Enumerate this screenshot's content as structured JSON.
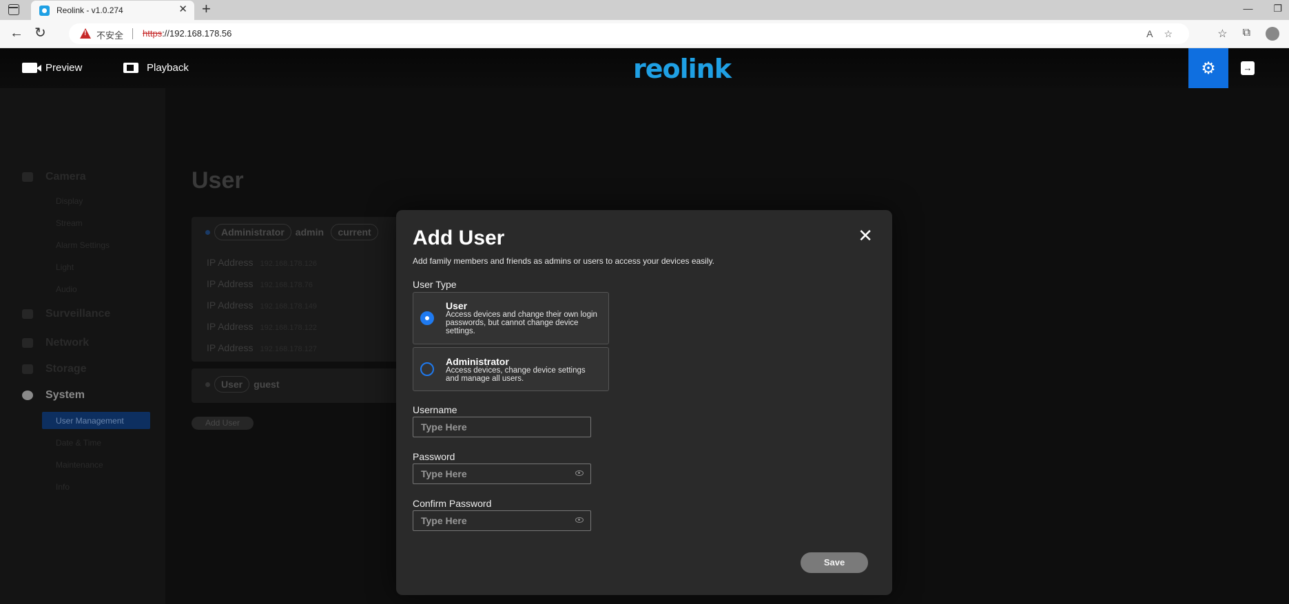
{
  "browser": {
    "tab_title": "Reolink - v1.0.274",
    "insecure_label": "不安全",
    "url_scheme": "https",
    "url_rest": "://192.168.178.56"
  },
  "header": {
    "preview_label": "Preview",
    "playback_label": "Playback",
    "logo_text": "reolink",
    "accent_color": "#0f6fe0"
  },
  "sidebar": {
    "groups": [
      {
        "label": "Camera",
        "items": [
          "Display",
          "Stream",
          "Alarm Settings",
          "Light",
          "Audio"
        ]
      },
      {
        "label": "Surveillance"
      },
      {
        "label": "Network"
      },
      {
        "label": "Storage"
      },
      {
        "label": "System",
        "items": [
          "User Management",
          "Date & Time",
          "Maintenance",
          "Info"
        ]
      }
    ]
  },
  "page": {
    "title": "User",
    "users": [
      {
        "role": "Administrator",
        "name": "admin",
        "tag": "current",
        "ips": [
          {
            "label": "IP Address",
            "value": "192.168.178.126"
          },
          {
            "label": "IP Address",
            "value": "192.168.178.76"
          },
          {
            "label": "IP Address",
            "value": "192.168.178.149"
          },
          {
            "label": "IP Address",
            "value": "192.168.178.122"
          },
          {
            "label": "IP Address",
            "value": "192.168.178.127"
          }
        ]
      },
      {
        "role": "User",
        "name": "guest"
      }
    ],
    "add_user_label": "Add User"
  },
  "modal": {
    "title": "Add User",
    "description": "Add family members and friends as admins or users to access your devices easily.",
    "user_type_label": "User Type",
    "types": [
      {
        "title": "User",
        "desc": "Access devices and change their own login passwords, but cannot change device settings.",
        "checked": true
      },
      {
        "title": "Administrator",
        "desc": "Access devices, change device settings and manage all users.",
        "checked": false
      }
    ],
    "username_label": "Username",
    "username_placeholder": "Type Here",
    "password_label": "Password",
    "password_placeholder": "Type Here",
    "confirm_label": "Confirm Password",
    "confirm_placeholder": "Type Here",
    "save_label": "Save"
  }
}
